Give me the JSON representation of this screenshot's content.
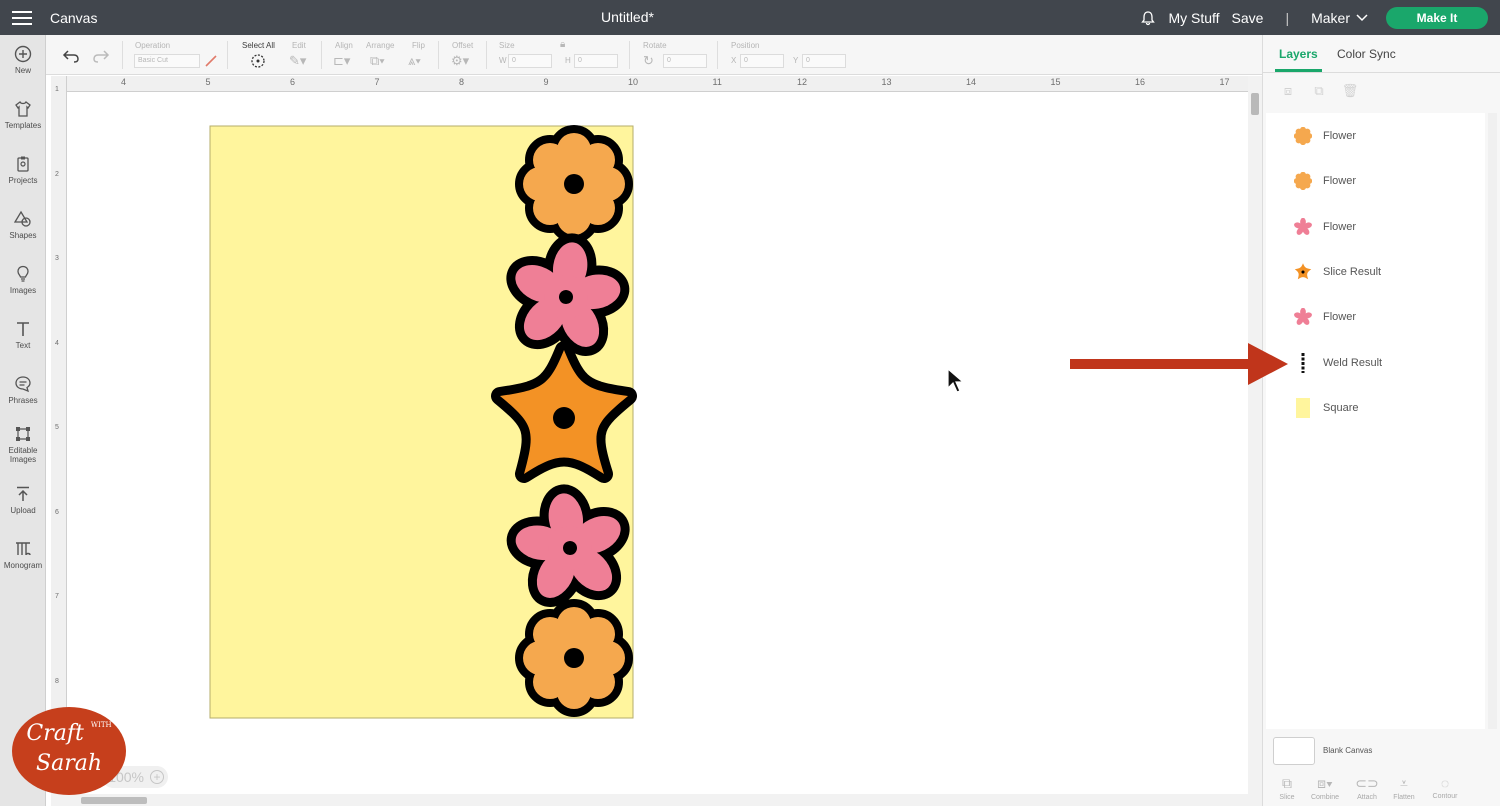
{
  "app": {
    "title": "Canvas"
  },
  "document": {
    "title": "Untitled*"
  },
  "header": {
    "my_stuff": "My Stuff",
    "save": "Save",
    "separator": "|",
    "machine": "Maker",
    "make_it": "Make It"
  },
  "sidebar": {
    "items": [
      {
        "label": "New",
        "icon": "plus-circle-icon"
      },
      {
        "label": "Templates",
        "icon": "shirt-icon"
      },
      {
        "label": "Projects",
        "icon": "clipboard-icon"
      },
      {
        "label": "Shapes",
        "icon": "shapes-icon"
      },
      {
        "label": "Images",
        "icon": "lightbulb-icon"
      },
      {
        "label": "Text",
        "icon": "text-icon"
      },
      {
        "label": "Phrases",
        "icon": "speech-bubble-icon"
      },
      {
        "label": "Editable",
        "label2": "Images",
        "icon": "editable-images-icon"
      },
      {
        "label": "Upload",
        "icon": "upload-icon"
      },
      {
        "label": "Monogram",
        "icon": "monogram-icon"
      }
    ]
  },
  "toolbar": {
    "operation": {
      "label": "Operation",
      "value": "Basic Cut"
    },
    "select_all": "Select All",
    "edit": "Edit",
    "align": "Align",
    "arrange": "Arrange",
    "flip": "Flip",
    "offset": "Offset",
    "size": {
      "label": "Size",
      "w": "W",
      "h": "H",
      "w_value": "0",
      "h_value": "0"
    },
    "rotate": {
      "label": "Rotate",
      "value": "0"
    },
    "position": {
      "label": "Position",
      "x": "X",
      "y": "Y",
      "x_value": "0",
      "y_value": "0"
    }
  },
  "ruler": {
    "top": [
      "4",
      "5",
      "6",
      "7",
      "8",
      "9",
      "10",
      "11",
      "12",
      "13",
      "14",
      "15",
      "16",
      "17"
    ],
    "left": [
      "1",
      "2",
      "3",
      "4",
      "5",
      "6",
      "7",
      "8"
    ]
  },
  "canvas": {
    "zoom": "100%",
    "zoom_plus": "+"
  },
  "panel": {
    "tabs": [
      "Layers",
      "Color Sync"
    ],
    "layers": [
      {
        "name": "Flower",
        "icon": "flower-orange-icon",
        "color": "#f5a84e"
      },
      {
        "name": "Flower",
        "icon": "flower-orange-icon",
        "color": "#f5a84e"
      },
      {
        "name": "Flower",
        "icon": "flower-pink-icon",
        "color": "#ef7f96"
      },
      {
        "name": "Slice Result",
        "icon": "star-flower-icon",
        "color": "#f39225"
      },
      {
        "name": "Flower",
        "icon": "flower-pink-icon",
        "color": "#ef7f96"
      },
      {
        "name": "Weld Result",
        "icon": "weld-outline-icon",
        "color": "#111111"
      },
      {
        "name": "Square",
        "icon": "square-icon",
        "color": "#fff59d"
      }
    ],
    "blank_canvas": "Blank Canvas",
    "bottom_tools": [
      "Slice",
      "Combine",
      "Attach",
      "Flatten",
      "Contour"
    ]
  },
  "watermark": {
    "line1": "Craft",
    "small": "WITH",
    "line2": "Sarah"
  },
  "colors": {
    "topbar": "#41464d",
    "accent": "#1aa76b",
    "card": "#fff59d",
    "flower_orange": "#f5a84e",
    "flower_pink": "#ef7f96",
    "star_orange": "#f39225",
    "arrow": "#c0351b"
  }
}
